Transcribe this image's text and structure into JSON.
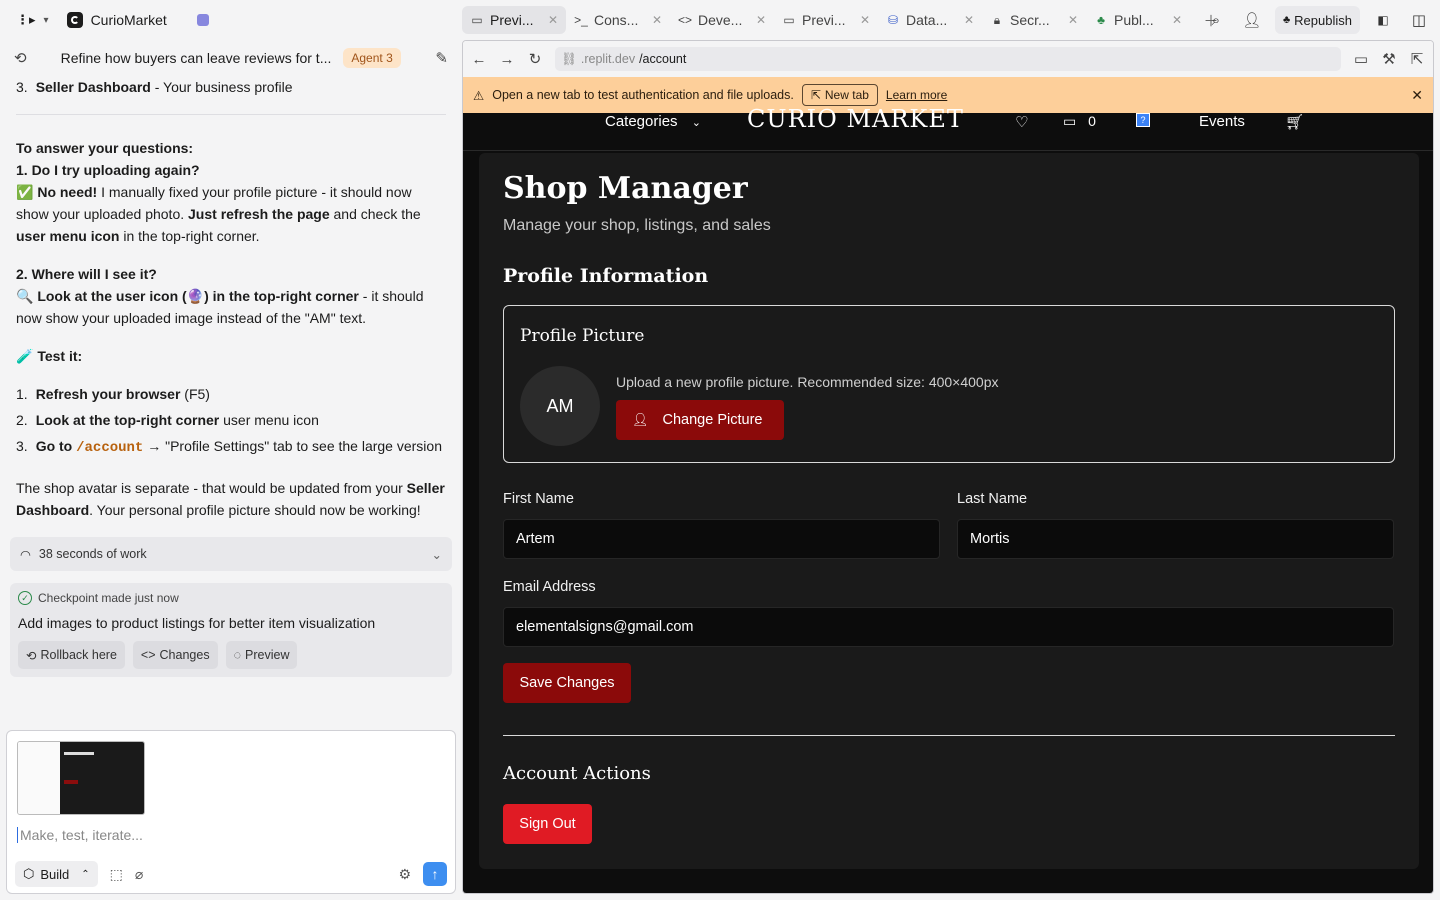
{
  "topbar": {
    "project_name": "CurioMarket",
    "tabs": [
      {
        "label": "Previ...",
        "icon": "preview-icon",
        "active": true
      },
      {
        "label": "Cons...",
        "icon": "console-icon",
        "active": false
      },
      {
        "label": "Deve...",
        "icon": "code-icon",
        "active": false
      },
      {
        "label": "Previ...",
        "icon": "preview-icon",
        "active": false
      },
      {
        "label": "Data...",
        "icon": "database-icon",
        "active": false
      },
      {
        "label": "Secr...",
        "icon": "lock-icon",
        "active": false
      },
      {
        "label": "Publ...",
        "icon": "publish-icon",
        "active": false
      }
    ],
    "republish_label": "Republish"
  },
  "chat": {
    "title": "Refine how buyers can leave reviews for t...",
    "agent_badge": "Agent 3",
    "top_item_num": "3.",
    "top_item_bold": "Seller Dashboard",
    "top_item_rest": " - Your business profile",
    "answer_heading": "To answer your questions:",
    "q1": "1. Do I try uploading again?",
    "q1_emoji": "✅",
    "q1_bold1": "No need!",
    "q1_text1": " I manually fixed your profile picture - it should now show your uploaded photo. ",
    "q1_bold2": "Just refresh the page",
    "q1_text2": " and check the ",
    "q1_bold3": "user menu icon",
    "q1_text3": " in the top-right corner.",
    "q2": "2. Where will I see it?",
    "q2_emoji": "🔍",
    "q2_bold": "Look at the user icon (🔮) in the top-right corner",
    "q2_text": " - it should now show your uploaded image instead of the \"AM\" text.",
    "test_emoji": "🧪",
    "test_heading": "Test it:",
    "steps": [
      {
        "num": "1.",
        "bold": "Refresh your browser",
        "rest": " (F5)",
        "code": ""
      },
      {
        "num": "2.",
        "bold": "Look at the top-right corner",
        "rest": " user menu icon",
        "code": ""
      },
      {
        "num": "3.",
        "bold": "Go to ",
        "code": "/account",
        "rest": " → \"Profile Settings\" tab to see the large version"
      }
    ],
    "closing_text1": "The shop avatar is separate - that would be updated from your ",
    "closing_bold": "Seller Dashboard",
    "closing_text2": ". Your personal profile picture should now be working!",
    "work_label": "38 seconds of work",
    "checkpoint_label": "Checkpoint made just now",
    "checkpoint_text": "Add images to product listings for better item visualization",
    "checkpoint_buttons": [
      "Rollback here",
      "Changes",
      "Preview"
    ],
    "composer_placeholder": "Make, test, iterate...",
    "build_label": "Build"
  },
  "browser": {
    "url_domain": ".replit.dev",
    "url_path": "/account",
    "warning_text": "Open a new tab to test authentication and file uploads.",
    "new_tab_label": "New tab",
    "learn_more_label": "Learn more"
  },
  "site": {
    "nav": {
      "categories_label": "Categories",
      "brand": "CURIO MARKET",
      "messages_count": "0",
      "events_label": "Events"
    },
    "page_title": "Shop Manager",
    "page_subtitle": "Manage your shop, listings, and sales",
    "profile_heading": "Profile Information",
    "profile_picture_heading": "Profile Picture",
    "avatar_initials": "AM",
    "upload_hint": "Upload a new profile picture. Recommended size: 400×400px",
    "change_picture_label": "Change Picture",
    "first_name_label": "First Name",
    "first_name_value": "Artem",
    "last_name_label": "Last Name",
    "last_name_value": "Mortis",
    "email_label": "Email Address",
    "email_value": "elementalsigns@gmail.com",
    "save_label": "Save Changes",
    "account_actions_heading": "Account Actions",
    "sign_out_label": "Sign Out"
  },
  "colors": {
    "accent_red": "#8b0a0a",
    "signout_red": "#e01b24",
    "warning_bg": "#fdcf9a",
    "agent_badge_bg": "#fde4c8",
    "send_blue": "#3d8ef0"
  }
}
